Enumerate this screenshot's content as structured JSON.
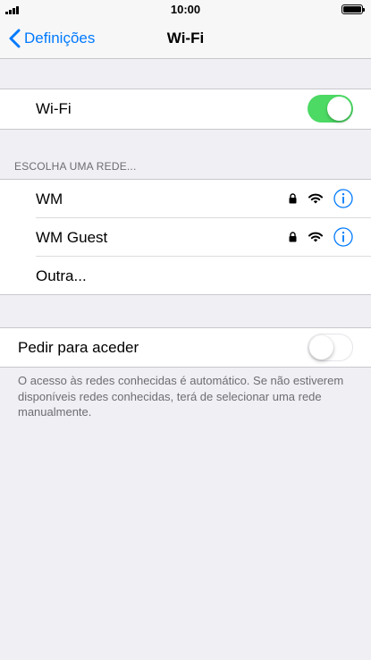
{
  "status_bar": {
    "time": "10:00"
  },
  "nav": {
    "back_label": "Definições",
    "title": "Wi-Fi"
  },
  "wifi_toggle": {
    "label": "Wi-Fi",
    "state": "on"
  },
  "networks": {
    "header": "ESCOLHA UMA REDE...",
    "items": [
      {
        "name": "WM",
        "secured": true
      },
      {
        "name": "WM Guest",
        "secured": true
      }
    ],
    "other_label": "Outra..."
  },
  "ask_to_join": {
    "label": "Pedir para aceder",
    "state": "off",
    "footer": "O acesso às redes conhecidas é automático. Se não estiverem disponíveis redes conhecidas, terá de selecionar uma rede manualmente."
  },
  "colors": {
    "accent": "#007aff",
    "toggle_on": "#4cd964",
    "background": "#efeff4"
  },
  "icons": [
    "signal-icon",
    "battery-icon",
    "chevron-left-icon",
    "lock-icon",
    "wifi-icon",
    "info-icon"
  ]
}
